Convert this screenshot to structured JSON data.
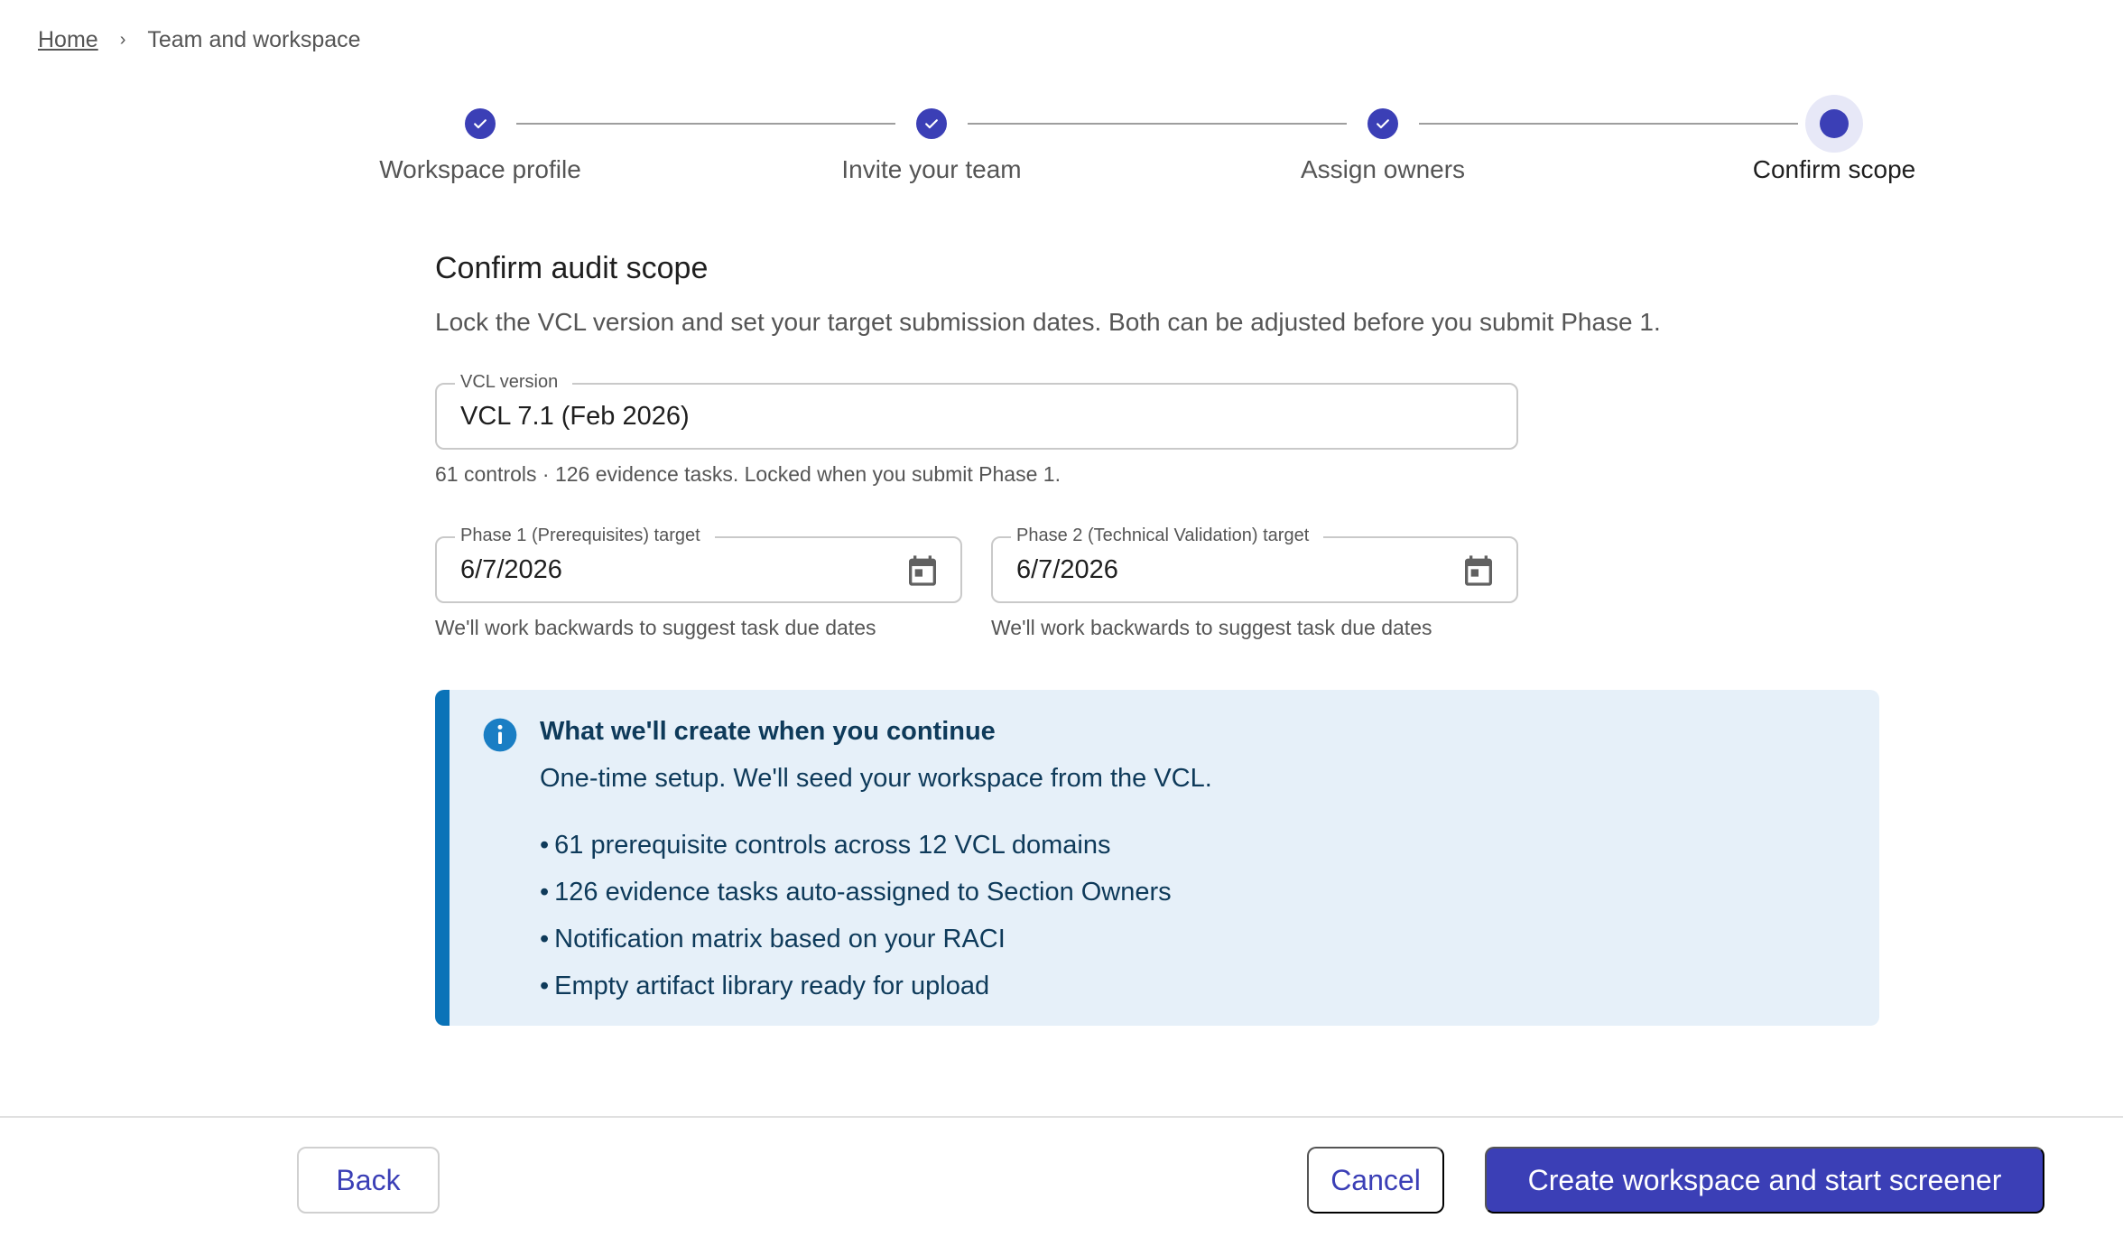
{
  "breadcrumb": {
    "home": "Home",
    "separator": "›",
    "current": "Team and workspace"
  },
  "stepper": {
    "steps": [
      {
        "label": "Workspace profile",
        "status": "complete"
      },
      {
        "label": "Invite your team",
        "status": "complete"
      },
      {
        "label": "Assign owners",
        "status": "complete"
      },
      {
        "label": "Confirm scope",
        "status": "active"
      }
    ]
  },
  "form": {
    "title": "Confirm audit scope",
    "subtitle": "Lock the VCL version and set your target submission dates. Both can be adjusted before you submit Phase 1.",
    "vcl": {
      "label": "VCL version",
      "value": "VCL 7.1 (Feb 2026)",
      "helper": "61 controls · 126 evidence tasks. Locked when you submit Phase 1."
    },
    "phase1": {
      "label": "Phase 1 (Prerequisites) target",
      "value": "6/7/2026",
      "helper": "We'll work backwards to suggest task due dates"
    },
    "phase2": {
      "label": "Phase 2 (Technical Validation) target",
      "value": "6/7/2026",
      "helper": "We'll work backwards to suggest task due dates"
    }
  },
  "callout": {
    "heading": "What we'll create when you continue",
    "description": "One-time setup. We'll seed your workspace from the VCL.",
    "items": [
      "61 prerequisite controls across 12 VCL domains",
      "126 evidence tasks auto-assigned to Section Owners",
      "Notification matrix based on your RACI",
      "Empty artifact library ready for upload"
    ]
  },
  "footer": {
    "back_label": "Back",
    "cancel_label": "Cancel",
    "primary_label": "Create workspace and start screener"
  },
  "colors": {
    "accent": "#3b3fb6",
    "info_bar": "#0a73b8",
    "info_bg": "#e6f0f9"
  }
}
